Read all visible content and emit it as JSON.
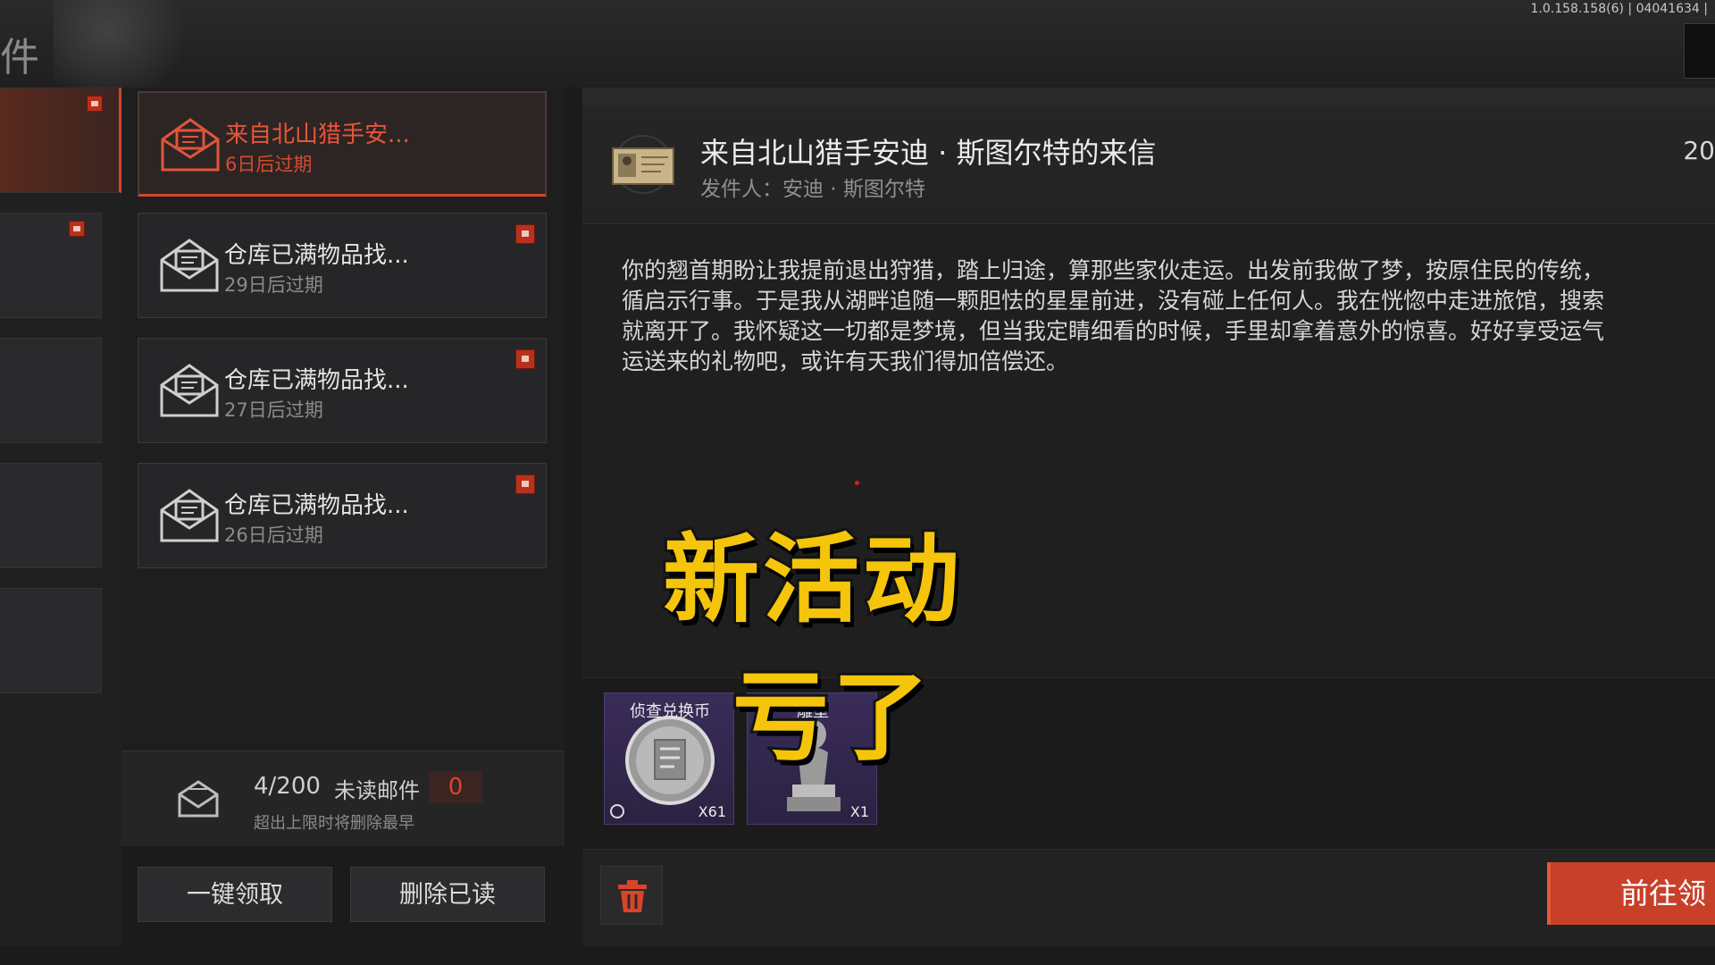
{
  "header": {
    "title_char": "件",
    "version": "1.0.158.158(6) | 04041634 |"
  },
  "mail_list": [
    {
      "title": "来自北山猎手安...",
      "expire": "6日后过期",
      "active": true,
      "has_gift": false
    },
    {
      "title": "仓库已满物品找...",
      "expire": "29日后过期",
      "active": false,
      "has_gift": true
    },
    {
      "title": "仓库已满物品找...",
      "expire": "27日后过期",
      "active": false,
      "has_gift": true
    },
    {
      "title": "仓库已满物品找...",
      "expire": "26日后过期",
      "active": false,
      "has_gift": true
    }
  ],
  "list_footer": {
    "count": "4/200",
    "unread_label": "未读邮件",
    "unread_count": "0",
    "limit_note": "超出上限时将删除最早"
  },
  "buttons": {
    "claim_all": "一键领取",
    "delete_read": "删除已读",
    "claim": "前往领"
  },
  "detail": {
    "title": "来自北山猎手安迪 · 斯图尔特的来信",
    "sender": "发件人：安迪 · 斯图尔特",
    "date": "20",
    "body_lines": [
      "你的翘首期盼让我提前退出狩猎，踏上归途，算那些家伙走运。出发前我做了梦，按原住民的传统，",
      "循启示行事。于是我从湖畔追随一颗胆怯的星星前进，没有碰上任何人。我在恍惚中走进旅馆，搜索",
      "就离开了。我怀疑这一切都是梦境，但当我定睛细看的时候，手里却拿着意外的惊喜。好好享受运气",
      "运送来的礼物吧，或许有天我们得加倍偿还。"
    ]
  },
  "rewards": [
    {
      "name": "侦查兑换币",
      "qty": "X61",
      "icon": "coin-icon"
    },
    {
      "name": "雕塑",
      "qty": "X1",
      "icon": "statue-icon"
    }
  ],
  "caption": {
    "line1": "新活动",
    "line2": "亏了"
  },
  "colors": {
    "accent": "#d4452a",
    "caption": "#f5c50c",
    "reward_bg": "#3a2c5a"
  }
}
